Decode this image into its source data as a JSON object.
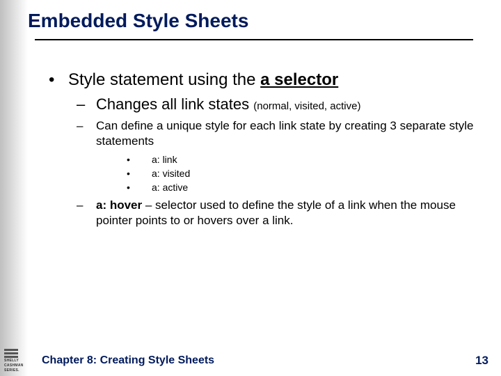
{
  "title": "Embedded Style Sheets",
  "bullets": {
    "l1": {
      "pre": "Style statement using the ",
      "bold_underline": "a selector"
    },
    "l2": [
      {
        "type": "big",
        "text": "Changes all link states ",
        "paren": "(normal, visited, active)"
      },
      {
        "type": "small",
        "text": "Can define a unique style for each link state by creating 3 separate style statements",
        "sub": [
          "a: link",
          "a: visited",
          "a: active"
        ]
      },
      {
        "type": "small_hover",
        "bold": "a: hover",
        "rest": " – selector used to define the style of a link when the mouse pointer points to or hovers over a link."
      }
    ]
  },
  "footer": {
    "chapter": "Chapter 8: Creating Style Sheets",
    "page": "13",
    "logo_lines": [
      "SHELLY",
      "CASHMAN",
      "SERIES."
    ]
  }
}
